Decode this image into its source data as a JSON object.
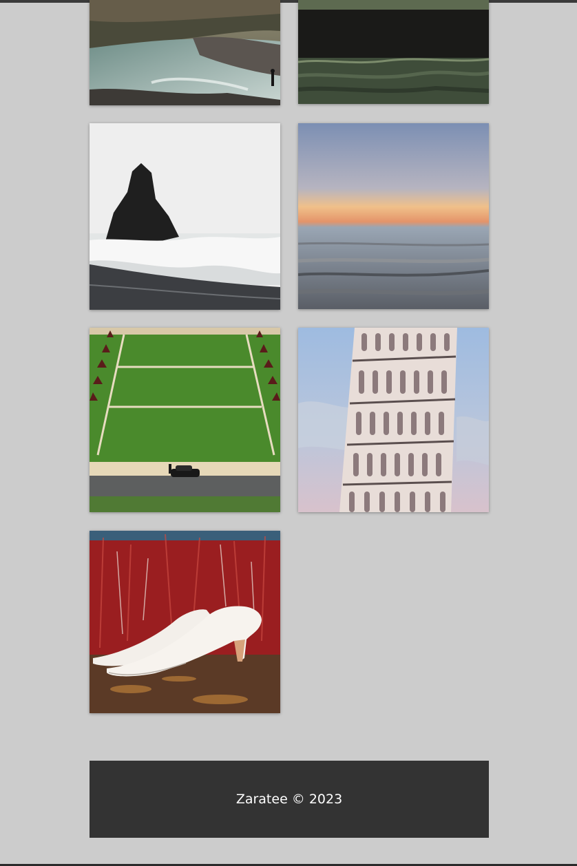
{
  "gallery": {
    "photos": [
      {
        "alt": "river-rocks"
      },
      {
        "alt": "dark-field"
      },
      {
        "alt": "sea-stack"
      },
      {
        "alt": "sunset-sea"
      },
      {
        "alt": "green-lawn"
      },
      {
        "alt": "leaning-tower"
      },
      {
        "alt": "white-heels"
      }
    ]
  },
  "footer": {
    "text": "Zaratee © 2023"
  }
}
